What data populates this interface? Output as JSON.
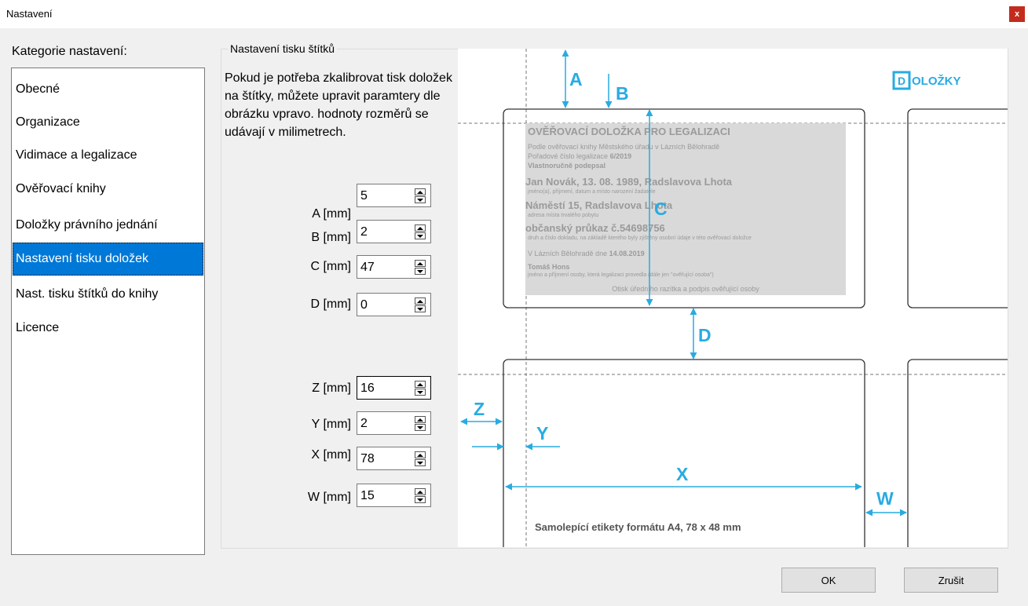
{
  "window": {
    "title": "Nastavení",
    "close_glyph": "x"
  },
  "categories": {
    "label": "Kategorie nastavení:",
    "items": [
      {
        "label": "Obecné"
      },
      {
        "label": "Organizace"
      },
      {
        "label": "Vidimace a legalizace"
      },
      {
        "label": "Ověřovací knihy"
      },
      {
        "label": "Doložky právního jednání"
      },
      {
        "label": "Nastavení tisku doložek",
        "selected": true
      },
      {
        "label": "Nast. tisku štítků do knihy"
      },
      {
        "label": "Licence"
      }
    ]
  },
  "panel": {
    "title": "Nastavení tisku štítků",
    "description": "Pokud je potřeba zkalibrovat tisk doložek na štítky, můžete upravit paramtery dle obrázku vpravo. hodnoty rozměrů se udávají v milimetrech.",
    "fields": [
      {
        "label": "A [mm]",
        "value": "5"
      },
      {
        "label": "B [mm]",
        "value": "2"
      },
      {
        "label": "C [mm]",
        "value": "47"
      },
      {
        "label": "D [mm]",
        "value": "0"
      },
      {
        "label": "Z [mm]",
        "value": "16"
      },
      {
        "label": "Y [mm]",
        "value": "2"
      },
      {
        "label": "X [mm]",
        "value": "78"
      },
      {
        "label": "W [mm]",
        "value": "15"
      }
    ]
  },
  "diagram": {
    "accent_color": "#29abe2",
    "logo_letter": "D",
    "logo_text": "OLOŽKY",
    "letters": {
      "a": "A",
      "b": "B",
      "c": "C",
      "d": "D",
      "z": "Z",
      "y": "Y",
      "x": "X",
      "w": "W"
    },
    "clause": {
      "heading": "OVĚŘOVACÍ DOLOŽKA PRO LEGALIZACI",
      "line1": "Podle ověřovací knihy Městského úřadu v Lázních Bělohradě",
      "line2_label": "Pořadové číslo legalizace",
      "line2_value": "6/2019",
      "line3": "Vlastnoručně podepsal",
      "name_line": "Jan Novák, 13. 08. 1989, Radslavova Lhota",
      "name_hint": "jméno(a), příjmení, datum a místo narození žadatele",
      "address_line": "Náměstí 15, Radslavova Lhota",
      "address_hint": "adresa místa trvalého pobytu",
      "id_line": "občanský průkaz č.54698756",
      "id_hint": "druh a číslo dokladu, na základě kterého byly zjištěny osobní údaje v této ověřovací doložce",
      "place_date_label": "V Lázních Bělohradě dne",
      "place_date_value": "14.08.2019",
      "officer": "Tomáš Hons",
      "officer_hint": "jméno a příjmení osoby, která legalizaci provedla (dále jen \"ověřující osoba\")",
      "stamp": "Otisk úředního razítka a podpis ověřující osoby"
    },
    "sheet_caption": "Samolepící etikety formátu A4, 78 x 48 mm"
  },
  "footer": {
    "ok_label": "OK",
    "cancel_label": "Zrušit"
  }
}
